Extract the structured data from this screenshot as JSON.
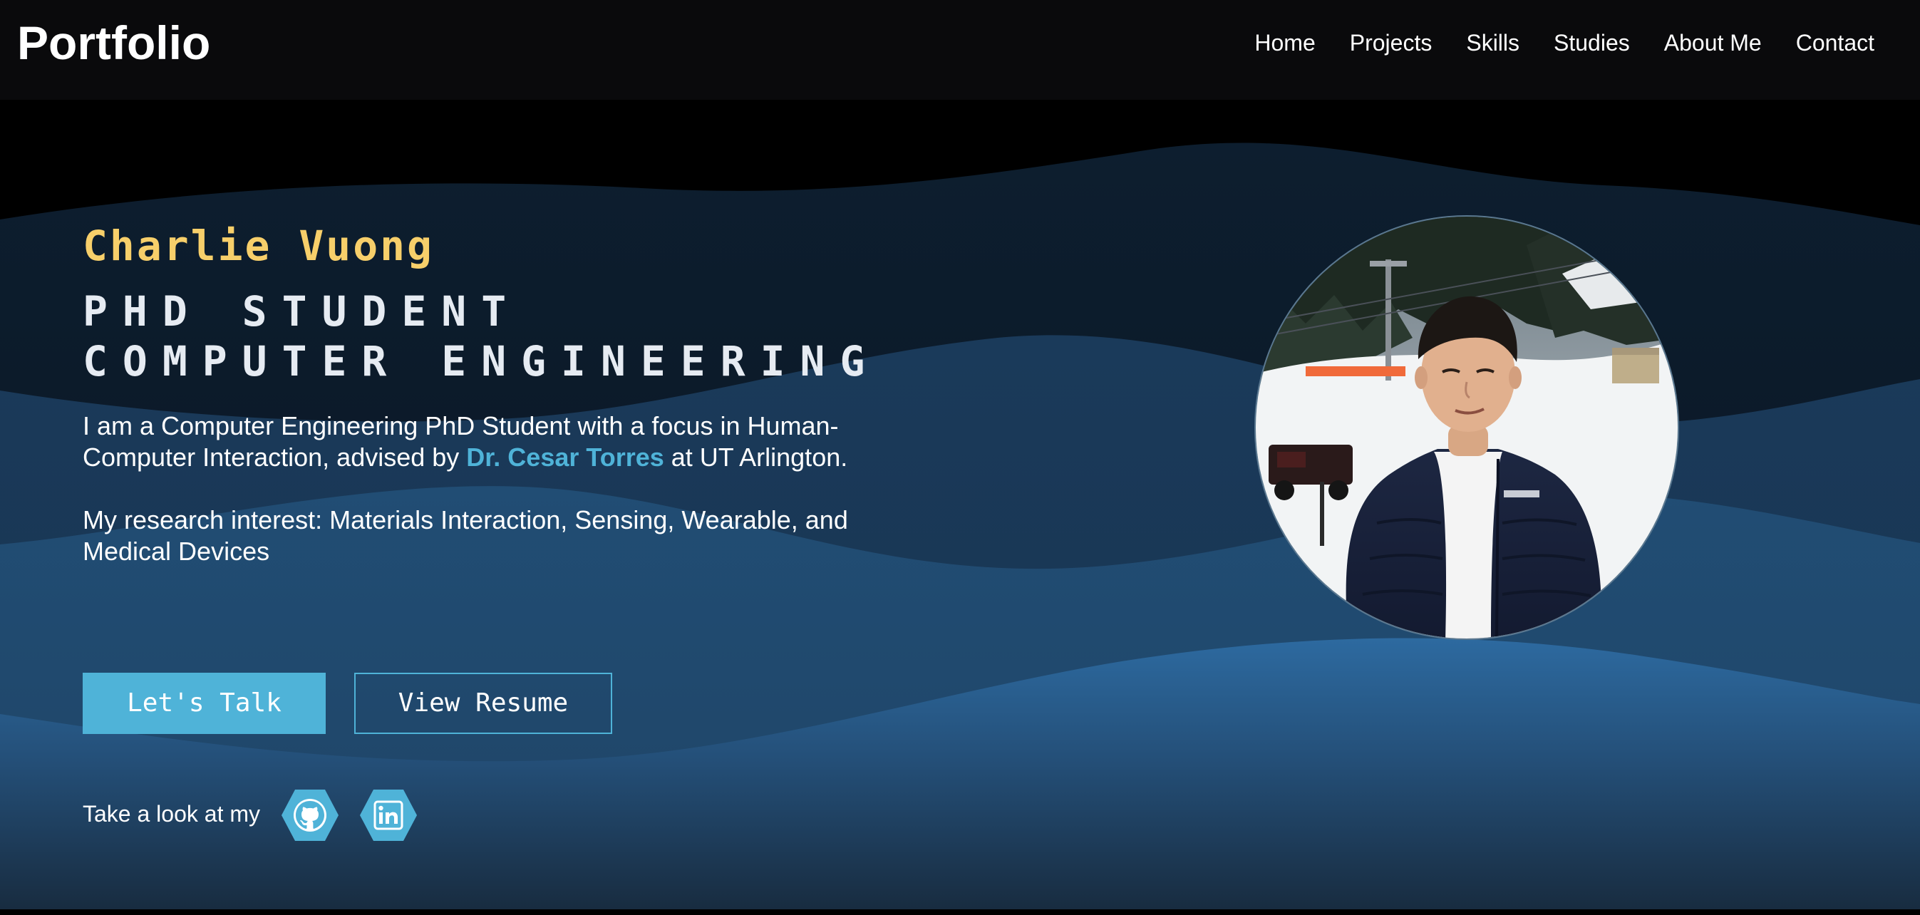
{
  "navbar": {
    "brand": "Portfolio",
    "links": [
      {
        "label": "Home"
      },
      {
        "label": "Projects"
      },
      {
        "label": "Skills"
      },
      {
        "label": "Studies"
      },
      {
        "label": "About Me"
      },
      {
        "label": "Contact"
      }
    ]
  },
  "hero": {
    "name": "Charlie Vuong",
    "role_line1": "PHD STUDENT",
    "role_line2": "COMPUTER ENGINEERING",
    "bio_before": "I am a Computer Engineering PhD Student with a focus in Human-Computer Interaction, advised by ",
    "advisor": "Dr. Cesar Torres",
    "bio_after": " at UT Arlington.",
    "research": "My research interest: Materials Interaction, Sensing, Wearable, and Medical Devices",
    "cta_primary": "Let's Talk",
    "cta_secondary": "View Resume",
    "social_label": "Take a look at my"
  },
  "icons": {
    "github": "github-icon",
    "linkedin": "linkedin-icon"
  },
  "colors": {
    "accent": "#4fb3d8",
    "name": "#f7cf6a",
    "navbar_bg": "#0a0a0c",
    "wave_dark": "#0c1a28",
    "wave_mid": "#1c3c5c",
    "wave_light": "#2a6aa0"
  }
}
